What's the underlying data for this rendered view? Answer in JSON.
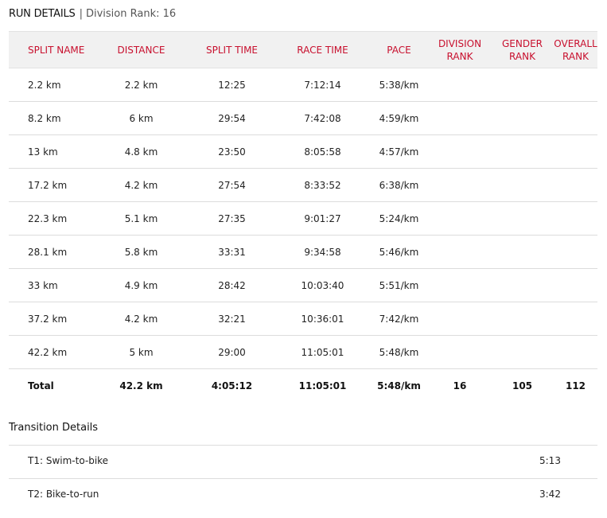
{
  "header": {
    "title": "RUN DETAILS",
    "separator": "|",
    "division_rank_text": "Division Rank: 16"
  },
  "table": {
    "columns": [
      {
        "line1": "SPLIT NAME",
        "line2": ""
      },
      {
        "line1": "DISTANCE",
        "line2": ""
      },
      {
        "line1": "SPLIT TIME",
        "line2": ""
      },
      {
        "line1": "RACE TIME",
        "line2": ""
      },
      {
        "line1": "PACE",
        "line2": ""
      },
      {
        "line1": "DIVISION",
        "line2": "RANK"
      },
      {
        "line1": "GENDER",
        "line2": "RANK"
      },
      {
        "line1": "OVERALL",
        "line2": "RANK"
      }
    ],
    "rows": [
      [
        "2.2 km",
        "2.2 km",
        "12:25",
        "7:12:14",
        "5:38/km",
        "",
        "",
        ""
      ],
      [
        "8.2 km",
        "6 km",
        "29:54",
        "7:42:08",
        "4:59/km",
        "",
        "",
        ""
      ],
      [
        "13 km",
        "4.8 km",
        "23:50",
        "8:05:58",
        "4:57/km",
        "",
        "",
        ""
      ],
      [
        "17.2 km",
        "4.2 km",
        "27:54",
        "8:33:52",
        "6:38/km",
        "",
        "",
        ""
      ],
      [
        "22.3 km",
        "5.1 km",
        "27:35",
        "9:01:27",
        "5:24/km",
        "",
        "",
        ""
      ],
      [
        "28.1 km",
        "5.8 km",
        "33:31",
        "9:34:58",
        "5:46/km",
        "",
        "",
        ""
      ],
      [
        "33 km",
        "4.9 km",
        "28:42",
        "10:03:40",
        "5:51/km",
        "",
        "",
        ""
      ],
      [
        "37.2 km",
        "4.2 km",
        "32:21",
        "10:36:01",
        "7:42/km",
        "",
        "",
        ""
      ],
      [
        "42.2 km",
        "5 km",
        "29:00",
        "11:05:01",
        "5:48/km",
        "",
        "",
        ""
      ]
    ],
    "total": [
      "Total",
      "42.2 km",
      "4:05:12",
      "11:05:01",
      "5:48/km",
      "16",
      "105",
      "112"
    ]
  },
  "transitions": {
    "title": "Transition Details",
    "items": [
      {
        "label": "T1: Swim-to-bike",
        "value": "5:13"
      },
      {
        "label": "T2: Bike-to-run",
        "value": "3:42"
      }
    ]
  },
  "colors": {
    "accent": "#c8102e",
    "header_bg": "#f1f1f1",
    "divider": "#dcdcdc"
  }
}
